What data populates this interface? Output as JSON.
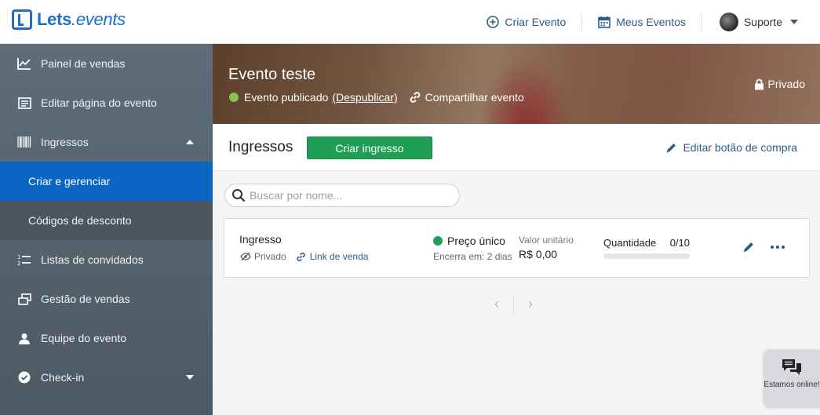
{
  "header": {
    "logo_bold": "Lets",
    "logo_rest": ".events",
    "create_event": "Criar Evento",
    "my_events": "Meus Eventos",
    "user_name": "Suporte"
  },
  "sidebar": {
    "items": [
      {
        "label": "Painel de vendas",
        "icon": "chart-line-icon"
      },
      {
        "label": "Editar página do evento",
        "icon": "page-icon"
      },
      {
        "label": "Ingressos",
        "icon": "barcode-icon",
        "expanded": true
      },
      {
        "label": "Criar e gerenciar",
        "sub": true,
        "active": true
      },
      {
        "label": "Códigos de desconto",
        "sub": true
      },
      {
        "label": "Listas de convidados",
        "icon": "numbered-list-icon"
      },
      {
        "label": "Gestão de vendas",
        "icon": "windows-icon"
      },
      {
        "label": "Equipe do evento",
        "icon": "users-icon"
      },
      {
        "label": "Check-in",
        "icon": "check-circle-icon"
      }
    ]
  },
  "event": {
    "title": "Evento teste",
    "status": "Evento publicado",
    "unpublish": "(Despublicar)",
    "share": "Compartilhar evento",
    "privacy": "Privado"
  },
  "section": {
    "title": "Ingressos",
    "create_button": "Criar ingresso",
    "edit_buy_button": "Editar botão de compra"
  },
  "search": {
    "placeholder": "Buscar por nome..."
  },
  "ticket": {
    "name": "Ingresso",
    "visibility": "Privado",
    "sale_link": "Link de venda",
    "price_type": "Preço único",
    "ends": "Encerra em: 2 dias",
    "unit_label": "Valor unitário",
    "unit_value": "R$ 0,00",
    "qty_label": "Quantidade",
    "qty_value": "0/10",
    "qty_fraction": 0
  },
  "pagination": {
    "prev": "‹",
    "next": "›"
  },
  "chat": {
    "text": "Estamos online!"
  },
  "colors": {
    "brand": "#1f6fc5",
    "green": "#1f9e55",
    "link": "#2d5b88",
    "sidebar_active": "#0a66c2"
  }
}
